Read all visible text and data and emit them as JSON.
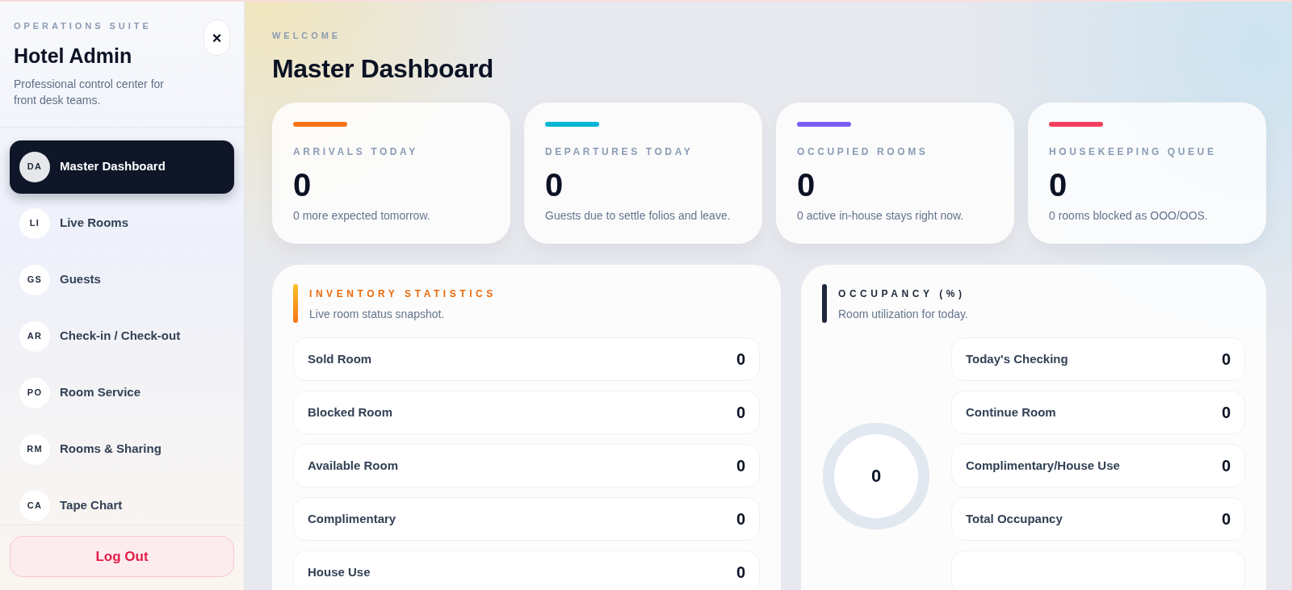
{
  "sidebar": {
    "eyebrow": "OPERATIONS SUITE",
    "title": "Hotel Admin",
    "subtitle": "Professional control center for front desk teams.",
    "close_label": "×",
    "items": [
      {
        "initials": "DA",
        "label": "Master Dashboard",
        "selected": true
      },
      {
        "initials": "LI",
        "label": "Live Rooms",
        "selected": false
      },
      {
        "initials": "GS",
        "label": "Guests",
        "selected": false
      },
      {
        "initials": "AR",
        "label": "Check-in / Check-out",
        "selected": false
      },
      {
        "initials": "PO",
        "label": "Room Service",
        "selected": false
      },
      {
        "initials": "RM",
        "label": "Rooms & Sharing",
        "selected": false
      },
      {
        "initials": "CA",
        "label": "Tape Chart",
        "selected": false
      }
    ],
    "logout": "Log Out"
  },
  "header": {
    "eyebrow": "WELCOME",
    "title": "Master Dashboard"
  },
  "stat_cards": [
    {
      "label": "ARRIVALS TODAY",
      "value": "0",
      "note": "0 more expected tomorrow.",
      "color": "#f97316"
    },
    {
      "label": "DEPARTURES TODAY",
      "value": "0",
      "note": "Guests due to settle folios and leave.",
      "color": "#06b6d4"
    },
    {
      "label": "OCCUPIED ROOMS",
      "value": "0",
      "note": "0 active in-house stays right now.",
      "color": "#7c5cf6"
    },
    {
      "label": "HOUSEKEEPING QUEUE",
      "value": "0",
      "note": "0 rooms blocked as OOO/OOS.",
      "color": "#f43f5e"
    }
  ],
  "inventory": {
    "title": "INVENTORY STATISTICS",
    "subtitle": "Live room status snapshot.",
    "rows": [
      {
        "label": "Sold Room",
        "value": "0"
      },
      {
        "label": "Blocked Room",
        "value": "0"
      },
      {
        "label": "Available Room",
        "value": "0"
      },
      {
        "label": "Complimentary",
        "value": "0"
      },
      {
        "label": "House Use",
        "value": "0"
      }
    ]
  },
  "occupancy": {
    "title": "OCCUPANCY (%)",
    "subtitle": "Room utilization for today.",
    "gauge": {
      "value": "0"
    },
    "rows": [
      {
        "label": "Today's Checking",
        "value": "0"
      },
      {
        "label": "Continue Room",
        "value": "0"
      },
      {
        "label": "Complimentary/House Use",
        "value": "0"
      },
      {
        "label": "Total Occupancy",
        "value": "0"
      }
    ]
  }
}
